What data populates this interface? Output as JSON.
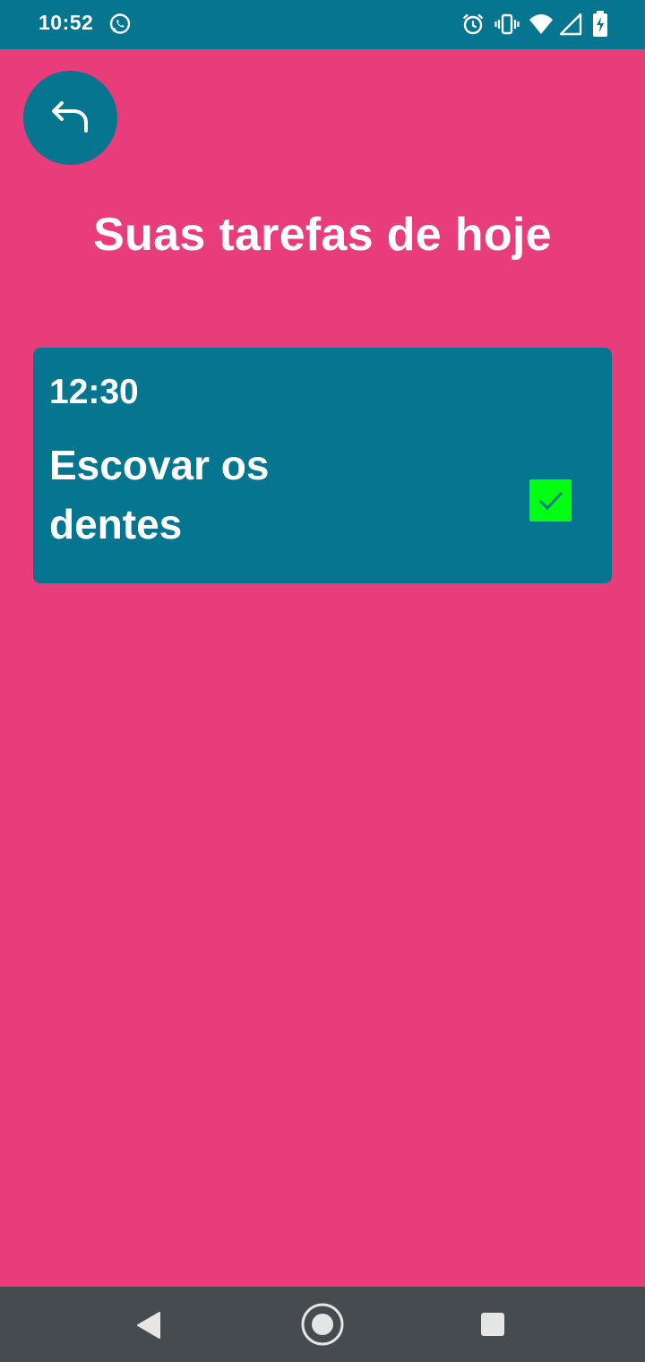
{
  "status_bar": {
    "time": "10:52",
    "icons": [
      "whatsapp-icon",
      "alarm-icon",
      "vibrate-icon",
      "wifi-icon",
      "signal-icon",
      "battery-icon"
    ],
    "background": "#06758F"
  },
  "header": {
    "back_icon": "reply-arrow-icon",
    "title": "Suas tarefas de hoje"
  },
  "tasks": [
    {
      "time": "12:30",
      "title": "Escovar os dentes",
      "completed": true
    }
  ],
  "nav_bar": {
    "buttons": [
      "back-triangle-icon",
      "home-circle-icon",
      "recents-square-icon"
    ],
    "background": "#464B4F"
  },
  "colors": {
    "page_background": "#E83D7A",
    "card_background": "#06758F",
    "checkbox_fill": "#00FF10"
  }
}
